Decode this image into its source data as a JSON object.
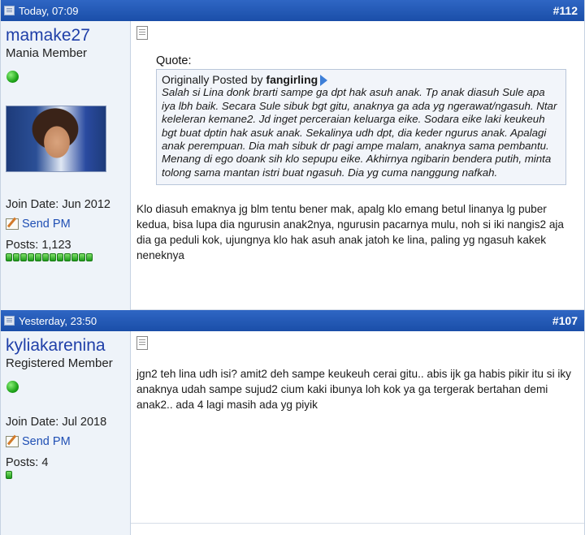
{
  "posts": [
    {
      "date": "Today, 07:09",
      "number": "112",
      "username": "mamake27",
      "usertitle": "Mania Member",
      "join_date": "Join Date: Jun 2012",
      "send_pm": "Send PM",
      "posts_count": "Posts: 1,123",
      "quote": {
        "label": "Quote:",
        "by_prefix": "Originally Posted by ",
        "author": "fangirling",
        "text": "Salah si Lina donk brarti sampe ga dpt hak asuh anak. Tp anak diasuh Sule apa iya lbh baik. Secara Sule sibuk bgt gitu, anaknya ga ada yg ngerawat/ngasuh. Ntar keleleran kemane2. Jd inget perceraian keluarga eike. Sodara eike laki keukeuh bgt buat dptin hak asuk anak. Sekalinya udh dpt, dia keder ngurus anak. Apalagi anak perempuan. Dia mah sibuk dr pagi ampe malam, anaknya sama pembantu. Menang di ego doank sih klo sepupu eike. Akhirnya ngibarin bendera putih, minta tolong sama mantan istri buat ngasuh. Dia yg cuma nanggung nafkah."
      },
      "text": "Klo diasuh emaknya jg blm tentu bener mak, apalg klo emang betul linanya lg puber kedua, bisa lupa dia ngurusin anak2nya, ngurusin pacarnya mulu, noh si iki nangis2 aja dia ga peduli kok, ujungnya klo hak asuh anak jatoh ke lina, paling yg ngasuh kakek neneknya"
    },
    {
      "date": "Yesterday, 23:50",
      "number": "107",
      "username": "kyliakarenina",
      "usertitle": "Registered Member",
      "join_date": "Join Date: Jul 2018",
      "send_pm": "Send PM",
      "posts_count": "Posts: 4",
      "text": "jgn2 teh lina udh isi? amit2 deh sampe keukeuh cerai gitu.. abis ijk ga habis pikir itu si iky anaknya udah sampe sujud2 cium kaki ibunya loh kok ya ga tergerak bertahan demi anak2.. ada 4 lagi masih ada yg piyik"
    }
  ],
  "colors": {
    "header": "#1f55b0",
    "username": "#1f3fa8",
    "sidebar": "#eef3f9",
    "online": "#22a81c"
  },
  "icons": [
    "post-icon",
    "online-status-icon",
    "send-pm-icon",
    "post-document-icon",
    "view-post-arrow-icon"
  ]
}
